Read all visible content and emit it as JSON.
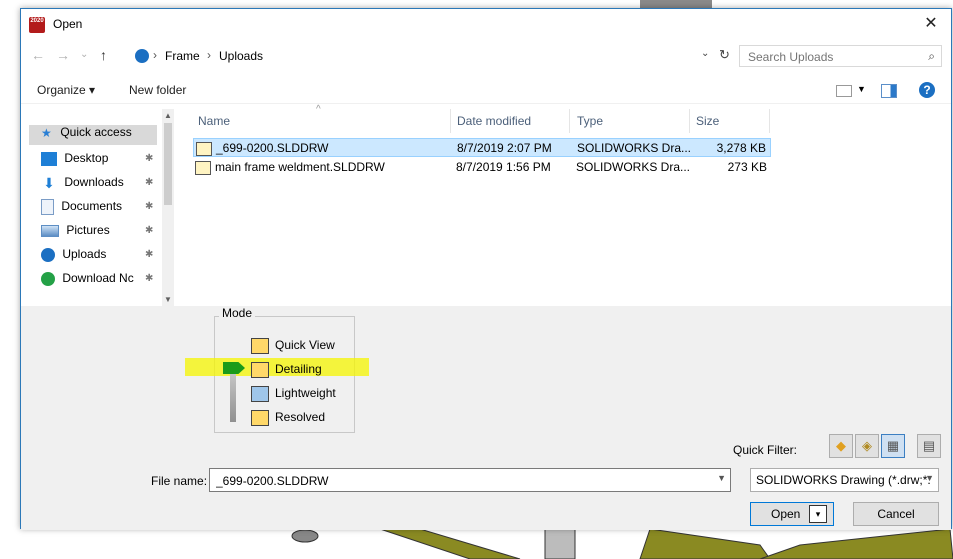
{
  "window": {
    "title": "Open",
    "close_glyph": "✕",
    "app_icon_text": "2020"
  },
  "nav": {
    "back_glyph": "←",
    "forward_glyph": "→",
    "history_glyph": "⌄",
    "up_glyph": "↑",
    "breadcrumb": [
      "Frame",
      "Uploads"
    ],
    "separator": "›",
    "dropdown_glyph": "⌄",
    "refresh_glyph": "↻"
  },
  "search": {
    "placeholder": "Search Uploads",
    "icon": "search-icon",
    "glyph": "⌕"
  },
  "toolbar": {
    "organize_label": "Organize ▾",
    "new_folder_label": "New folder",
    "help_glyph": "?"
  },
  "sidebar": {
    "items": [
      {
        "label": "Quick access",
        "icon": "star-icon",
        "color": "#2a7fd4"
      },
      {
        "label": "Desktop",
        "icon": "desktop-icon",
        "color": "#1e7fd6"
      },
      {
        "label": "Downloads",
        "icon": "download-icon",
        "color": "#1e7fd6"
      },
      {
        "label": "Documents",
        "icon": "document-icon",
        "color": "#7a9cc6"
      },
      {
        "label": "Pictures",
        "icon": "pictures-icon",
        "color": "#5d8ec4"
      },
      {
        "label": "Uploads",
        "icon": "uploads-icon",
        "color": "#1b6fc2"
      },
      {
        "label": "Download Nc",
        "icon": "download-nc-icon",
        "color": "#24a147"
      }
    ],
    "pin_glyph": "✱"
  },
  "file_list": {
    "columns": [
      "Name",
      "Date modified",
      "Type",
      "Size"
    ],
    "rows": [
      {
        "name": "_699-0200.SLDDRW",
        "date": "8/7/2019 2:07 PM",
        "type": "SOLIDWORKS Dra...",
        "size": "3,278 KB",
        "selected": true
      },
      {
        "name": "main frame weldment.SLDDRW",
        "date": "8/7/2019 1:56 PM",
        "type": "SOLIDWORKS Dra...",
        "size": "273 KB",
        "selected": false
      }
    ]
  },
  "mode": {
    "legend": "Mode",
    "options": [
      "Quick View",
      "Detailing",
      "Lightweight",
      "Resolved"
    ],
    "selected": "Detailing",
    "highlight_color": "#f6f600",
    "pointer_color": "#1a9b1a"
  },
  "quick_filter": {
    "label": "Quick Filter:"
  },
  "file_name": {
    "label": "File name:",
    "value": "_699-0200.SLDDRW"
  },
  "file_type": {
    "value": "SOLIDWORKS Drawing (*.drw;*."
  },
  "buttons": {
    "open_label": "Open",
    "cancel_label": "Cancel",
    "split_glyph": "▾"
  },
  "colors": {
    "accent": "#0078d7",
    "selection": "#cce8ff",
    "panel": "#f0f0f0"
  }
}
